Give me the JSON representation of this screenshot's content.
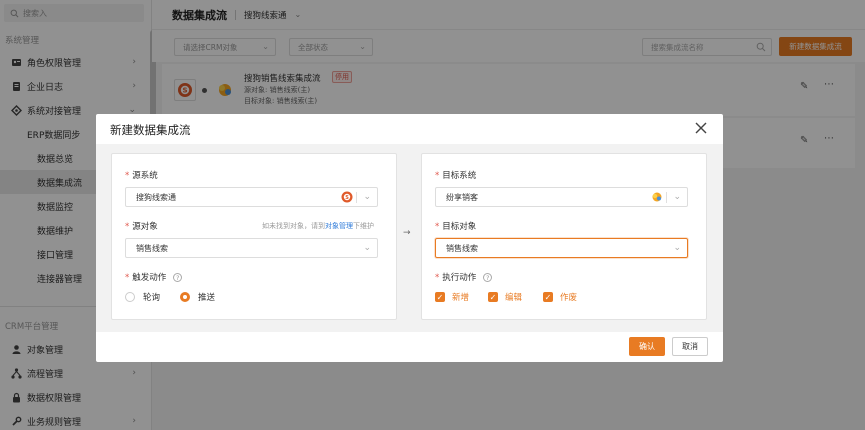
{
  "colors": {
    "accent": "#e87b23",
    "danger": "#e05a4f",
    "link": "#2f7bd9"
  },
  "sidebar": {
    "search_placeholder": "搜索入",
    "groups": [
      {
        "label": "系统管理",
        "items": [
          {
            "label": "角色权限管理",
            "icon": "user-card-icon"
          },
          {
            "label": "企业日志",
            "icon": "document-icon"
          },
          {
            "label": "系统对接管理",
            "icon": "link-icon"
          }
        ]
      },
      {
        "label": "CRM平台管理",
        "items": [
          {
            "label": "对象管理",
            "icon": "person-icon"
          },
          {
            "label": "流程管理",
            "icon": "flow-icon"
          },
          {
            "label": "数据权限管理",
            "icon": "lock-icon"
          },
          {
            "label": "业务规则管理",
            "icon": "wrench-icon"
          }
        ]
      }
    ],
    "sub_items": [
      "ERP数据同步",
      "数据总览",
      "数据集成流",
      "数据监控",
      "数据维护",
      "接口管理",
      "连接器管理"
    ]
  },
  "topbar": {
    "title": "数据集成流",
    "subtitle": "搜狗线索通"
  },
  "filters": {
    "crm_object_placeholder": "请选择CRM对象",
    "status_placeholder": "全部状态",
    "search_placeholder": "搜索集成流名称",
    "new_button": "新建数据集成流"
  },
  "flows": [
    {
      "title": "搜狗销售线索集成流",
      "badge": "停用",
      "source_line": "源对象: 销售线索(主)",
      "target_line": "目标对象: 销售线索(主)"
    }
  ],
  "modal": {
    "title": "新建数据集成流",
    "source_system_label": "源系统",
    "source_system_value": "搜狗线索通",
    "source_object_label": "源对象",
    "source_object_hint_prefix": "如未找到对象，请到",
    "source_object_hint_link": "对象管理",
    "source_object_hint_suffix": "下维护",
    "source_object_value": "销售线索",
    "trigger_label": "触发动作",
    "trigger_options": [
      "轮询",
      "推送"
    ],
    "trigger_selected": "推送",
    "target_system_label": "目标系统",
    "target_system_value": "纷享销客",
    "target_object_label": "目标对象",
    "target_object_value": "销售线索",
    "action_label": "执行动作",
    "actions": [
      "新增",
      "编辑",
      "作废"
    ],
    "arrow": "→",
    "confirm": "确认",
    "cancel": "取消"
  }
}
